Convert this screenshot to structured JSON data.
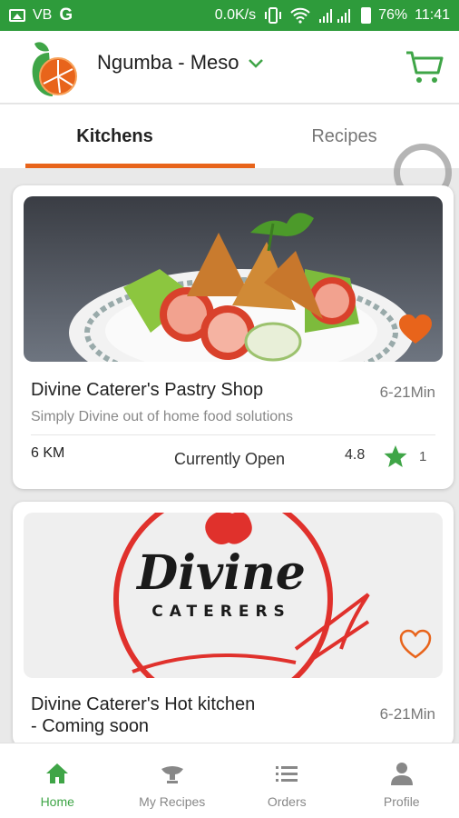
{
  "status_bar": {
    "carrier": "VB",
    "network_icon": "G",
    "speed": "0.0K/s",
    "battery": "76%",
    "time": "11:41",
    "icons": [
      "image-icon",
      "vibrate-icon",
      "wifi-icon",
      "signal-icon",
      "battery-icon"
    ]
  },
  "header": {
    "location": "Ngumba - Meso",
    "icons": [
      "logo-icon",
      "chevron-down-icon",
      "cart-icon"
    ]
  },
  "tabs": [
    {
      "label": "Kitchens",
      "active": true
    },
    {
      "label": "Recipes",
      "active": false
    }
  ],
  "kitchens": [
    {
      "name": "Divine Caterer's Pastry Shop",
      "time": "6-21Min",
      "description": "Simply Divine out of home food solutions",
      "distance": "6 KM",
      "status": "Currently Open",
      "rating": "4.8",
      "rating_count": "1",
      "favorite": true
    },
    {
      "name_line1": "Divine Caterer's Hot kitchen",
      "name_line2": "- Coming soon",
      "time": "6-21Min",
      "logo_word": "Divine",
      "logo_sub": "CATERERS",
      "favorite": false
    }
  ],
  "bottom_nav": [
    {
      "label": "Home",
      "icon": "home-icon",
      "active": true
    },
    {
      "label": "My Recipes",
      "icon": "chef-hat-icon",
      "active": false
    },
    {
      "label": "Orders",
      "icon": "list-icon",
      "active": false
    },
    {
      "label": "Profile",
      "icon": "person-icon",
      "active": false
    }
  ],
  "colors": {
    "status_bar": "#2e9b3b",
    "accent_orange": "#e8641b",
    "accent_green": "#3fa547"
  }
}
